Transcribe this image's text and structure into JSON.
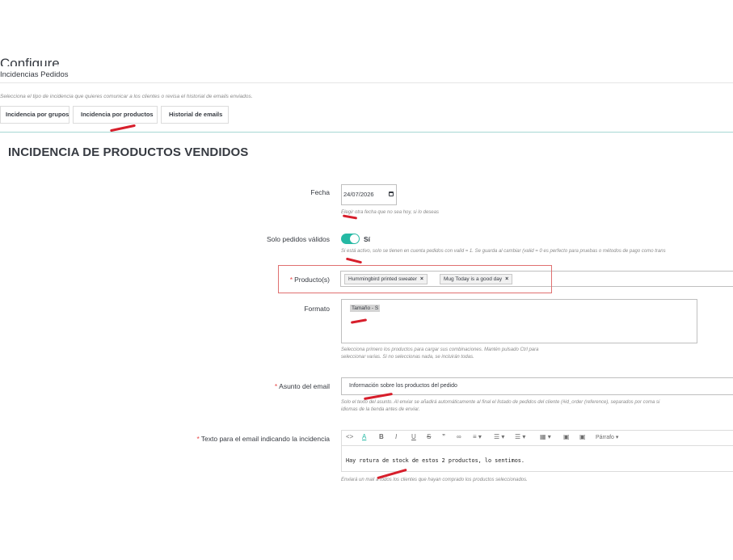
{
  "header": {
    "title": "Configure",
    "subtitle": "Incidencias Pedidos"
  },
  "intro": "Selecciona el tipo de incidencia que quieres comunicar a los clientes o revisa el historial de emails enviados.",
  "tabs": [
    {
      "label": "Incidencia por grupos"
    },
    {
      "label": "Incidencia por productos"
    },
    {
      "label": "Historial de emails"
    }
  ],
  "section_title": "INCIDENCIA DE PRODUCTOS VENDIDOS",
  "form": {
    "fecha": {
      "label": "Fecha",
      "value": "24/07/2026",
      "help": "Elegir otra fecha que no sea hoy, si lo deseas"
    },
    "solo_validos": {
      "label": "Solo pedidos válidos",
      "state": "Sí",
      "help": "Si está activo, solo se tienen en cuenta pedidos con valid = 1. Se guarda al cambiar (valid = 0 es perfecto para pruebas o métodos de pago como trans"
    },
    "productos": {
      "required": "*",
      "label": "Producto(s)",
      "chips": [
        "Hummingbird printed sweater",
        "Mug Today is a good day"
      ],
      "remove": "×"
    },
    "formato": {
      "label": "Formato",
      "option": "Tamaño - S",
      "help1": "Selecciona primero los productos para cargar sus combinaciones. Mantén pulsado Ctrl para",
      "help2": "seleccionar varias. Si no seleccionas nada, se incluirán todas."
    },
    "asunto": {
      "required": "*",
      "label": "Asunto del email",
      "value": "Información sobre los productos del pedido",
      "help1": "Solo el texto del asunto. Al enviar se añadirá automáticamente al final el listado de pedidos del cliente (#id_order (reference), separados por coma si",
      "help2": "idiomas de la tienda antes de enviar."
    },
    "texto": {
      "required": "*",
      "label": "Texto para el email indicando la incidencia",
      "toolbar": {
        "code": "<>",
        "font_color": "A",
        "bold": "B",
        "italic": "I",
        "underline": "U",
        "strike": "S",
        "quote": "”",
        "link": "∞",
        "align": "≡ ▾",
        "bullets": "☰ ▾",
        "numbers": "☰ ▾",
        "table": "▦ ▾",
        "image": "▣",
        "media": "▣",
        "paragraph": "Párrafo ▾"
      },
      "value": "Hay rotura de stock de estos 2 productos, lo sentimos.",
      "help": "Enviará un mail a todos los clientes que hayan comprado los productos seleccionados."
    }
  },
  "colors": {
    "accent": "#25b9a4",
    "annotation_red": "#d71e2b",
    "highlight_border": "#e07070"
  }
}
